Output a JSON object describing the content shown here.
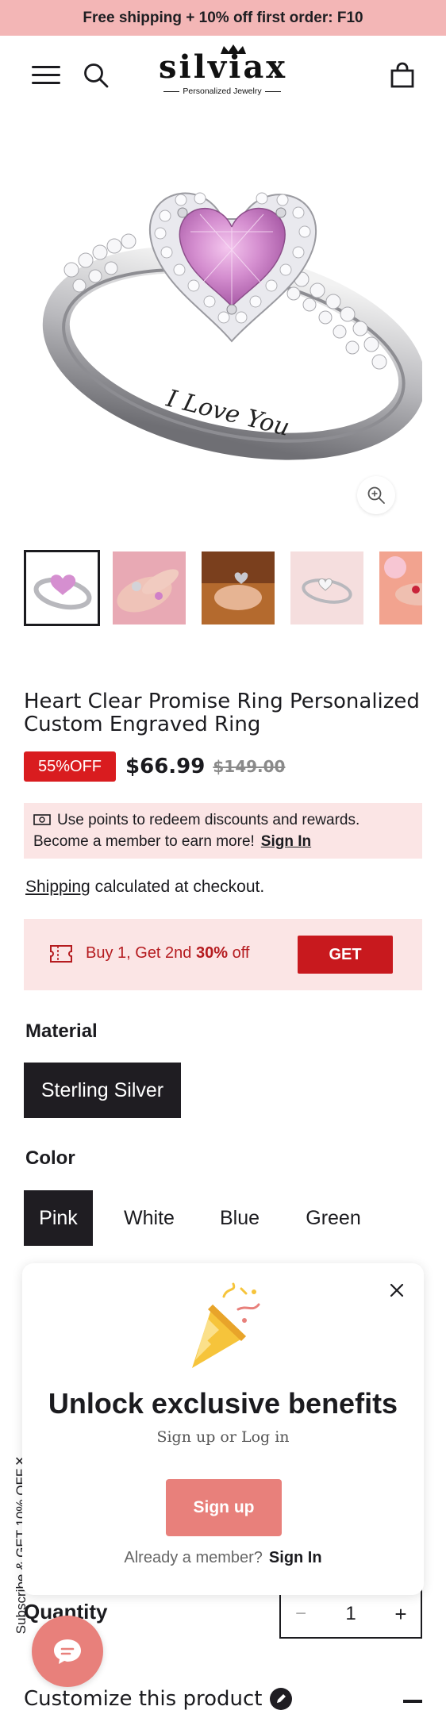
{
  "announcement": {
    "text": "Free shipping + 10% off first order: F10"
  },
  "header": {
    "logo_word": "silviax",
    "logo_tagline": "Personalized Jewelry"
  },
  "product": {
    "image_alt": "Heart ring engraved I Love You",
    "engraving": "I Love You",
    "title": "Heart Clear Promise Ring Personalized Custom Engraved Ring",
    "discount_badge": "55%OFF",
    "price_now": "$66.99",
    "price_was": "$149.00",
    "thumbnail_count": 5
  },
  "points_banner": {
    "line1": "Use points to redeem discounts and rewards.",
    "line2": "Become a member to earn more!",
    "sign_in": "Sign In"
  },
  "shipping": {
    "link": "Shipping",
    "text": " calculated at checkout."
  },
  "promo": {
    "text_prefix": "Buy 1, Get 2nd ",
    "text_bold": "30%",
    "text_suffix": " off",
    "button": "GET"
  },
  "options": {
    "material_label": "Material",
    "material_values": [
      "Sterling Silver"
    ],
    "material_selected": "Sterling Silver",
    "color_label": "Color",
    "color_values": [
      "Pink",
      "White",
      "Blue",
      "Green"
    ],
    "color_selected": "Pink"
  },
  "quantity": {
    "label": "Quantity",
    "value": "1",
    "minus": "−",
    "plus": "+"
  },
  "customize": {
    "label": "Customize this product"
  },
  "side_tab": {
    "text": "Subscribe & GET 10% OFF",
    "close": "✕"
  },
  "popup": {
    "title": "Unlock exclusive benefits",
    "subtitle": "Sign up or Log in",
    "signup_button": "Sign up",
    "member_text": "Already a member?",
    "signin_link": "Sign In"
  },
  "colors": {
    "announcement_bg": "#f3b6b6",
    "sale_red": "#d91c1f",
    "promo_bg": "#fbe5e5",
    "accent_coral": "#e8807b",
    "dark": "#1f1d22"
  },
  "icons": {
    "menu": "hamburger-menu-icon",
    "search": "search-icon",
    "cart": "shopping-bag-icon",
    "zoom": "zoom-in-icon",
    "points": "cash-icon",
    "promo": "ticket-icon",
    "chat": "chat-bubble-icon",
    "popup": "party-popper-icon",
    "close": "close-icon"
  }
}
